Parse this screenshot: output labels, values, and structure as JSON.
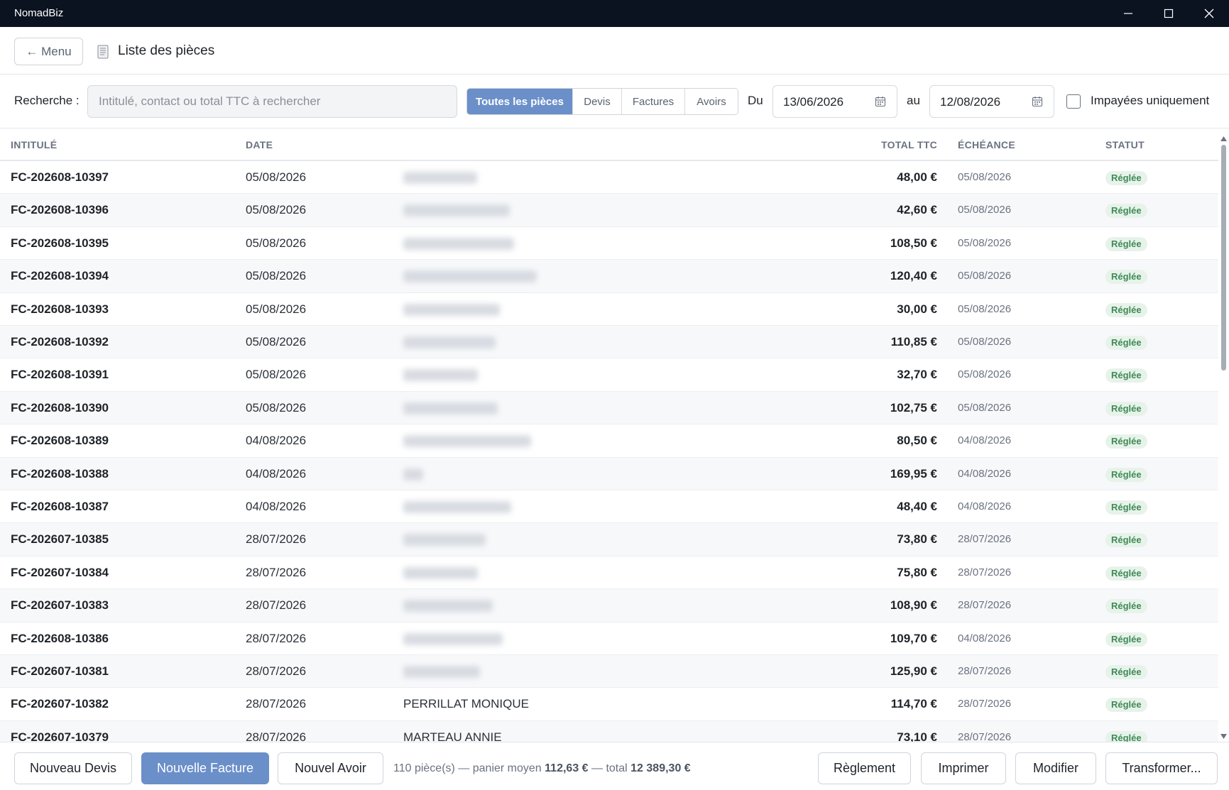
{
  "window": {
    "title": "NomadBiz",
    "controls": [
      "minimize",
      "maximize",
      "close"
    ]
  },
  "header": {
    "menu_label": "← Menu",
    "page_icon": "document-icon",
    "page_title": "Liste des pièces"
  },
  "filters": {
    "search_label": "Recherche :",
    "search_placeholder": "Intitulé, contact ou total TTC à rechercher",
    "search_value": "",
    "types": [
      {
        "label": "Toutes les pièces",
        "active": true
      },
      {
        "label": "Devis",
        "active": false
      },
      {
        "label": "Factures",
        "active": false
      },
      {
        "label": "Avoirs",
        "active": false
      }
    ],
    "from_label": "Du",
    "from_date": "13/06/2026",
    "to_label": "au",
    "to_date": "12/08/2026",
    "unpaid_label": "Impayées uniquement",
    "unpaid_checked": false
  },
  "table": {
    "headers": {
      "intitule": "INTITULÉ",
      "date": "DATE",
      "total": "TOTAL TTC",
      "echeance": "ÉCHÉANCE",
      "statut": "STATUT"
    },
    "rows": [
      {
        "intitule": "FC-202608-10397",
        "date": "05/08/2026",
        "contact": "",
        "total": "48,00 €",
        "echeance": "05/08/2026",
        "statut": "Réglée"
      },
      {
        "intitule": "FC-202608-10396",
        "date": "05/08/2026",
        "contact": "",
        "total": "42,60 €",
        "echeance": "05/08/2026",
        "statut": "Réglée"
      },
      {
        "intitule": "FC-202608-10395",
        "date": "05/08/2026",
        "contact": "",
        "total": "108,50 €",
        "echeance": "05/08/2026",
        "statut": "Réglée"
      },
      {
        "intitule": "FC-202608-10394",
        "date": "05/08/2026",
        "contact": "",
        "total": "120,40 €",
        "echeance": "05/08/2026",
        "statut": "Réglée"
      },
      {
        "intitule": "FC-202608-10393",
        "date": "05/08/2026",
        "contact": "",
        "total": "30,00 €",
        "echeance": "05/08/2026",
        "statut": "Réglée"
      },
      {
        "intitule": "FC-202608-10392",
        "date": "05/08/2026",
        "contact": "",
        "total": "110,85 €",
        "echeance": "05/08/2026",
        "statut": "Réglée"
      },
      {
        "intitule": "FC-202608-10391",
        "date": "05/08/2026",
        "contact": "",
        "total": "32,70 €",
        "echeance": "05/08/2026",
        "statut": "Réglée"
      },
      {
        "intitule": "FC-202608-10390",
        "date": "05/08/2026",
        "contact": "",
        "total": "102,75 €",
        "echeance": "05/08/2026",
        "statut": "Réglée"
      },
      {
        "intitule": "FC-202608-10389",
        "date": "04/08/2026",
        "contact": "",
        "total": "80,50 €",
        "echeance": "04/08/2026",
        "statut": "Réglée"
      },
      {
        "intitule": "FC-202608-10388",
        "date": "04/08/2026",
        "contact": "",
        "total": "169,95 €",
        "echeance": "04/08/2026",
        "statut": "Réglée"
      },
      {
        "intitule": "FC-202608-10387",
        "date": "04/08/2026",
        "contact": "",
        "total": "48,40 €",
        "echeance": "04/08/2026",
        "statut": "Réglée"
      },
      {
        "intitule": "FC-202607-10385",
        "date": "28/07/2026",
        "contact": "",
        "total": "73,80 €",
        "echeance": "28/07/2026",
        "statut": "Réglée"
      },
      {
        "intitule": "FC-202607-10384",
        "date": "28/07/2026",
        "contact": "",
        "total": "75,80 €",
        "echeance": "28/07/2026",
        "statut": "Réglée"
      },
      {
        "intitule": "FC-202607-10383",
        "date": "28/07/2026",
        "contact": "",
        "total": "108,90 €",
        "echeance": "28/07/2026",
        "statut": "Réglée"
      },
      {
        "intitule": "FC-202608-10386",
        "date": "28/07/2026",
        "contact": "",
        "total": "109,70 €",
        "echeance": "04/08/2026",
        "statut": "Réglée"
      },
      {
        "intitule": "FC-202607-10381",
        "date": "28/07/2026",
        "contact": "",
        "total": "125,90 €",
        "echeance": "28/07/2026",
        "statut": "Réglée"
      },
      {
        "intitule": "FC-202607-10382",
        "date": "28/07/2026",
        "contact": "PERRILLAT MONIQUE",
        "total": "114,70 €",
        "echeance": "28/07/2026",
        "statut": "Réglée"
      },
      {
        "intitule": "FC-202607-10379",
        "date": "28/07/2026",
        "contact": "MARTEAU ANNIE",
        "total": "73,10 €",
        "echeance": "28/07/2026",
        "statut": "Réglée"
      }
    ]
  },
  "footer": {
    "new_devis": "Nouveau Devis",
    "new_facture": "Nouvelle Facture",
    "new_avoir": "Nouvel Avoir",
    "count_text": "110 pièce(s) — panier moyen",
    "average": "112,63 €",
    "total_text": "— total",
    "total": "12 389,30 €",
    "reglement": "Règlement",
    "imprimer": "Imprimer",
    "modifier": "Modifier",
    "transformer": "Transformer..."
  },
  "colors": {
    "accent": "#6b8fc9",
    "titlebar": "#0b1220",
    "badge_bg": "#e7f3ea",
    "badge_text": "#3f8a55"
  }
}
